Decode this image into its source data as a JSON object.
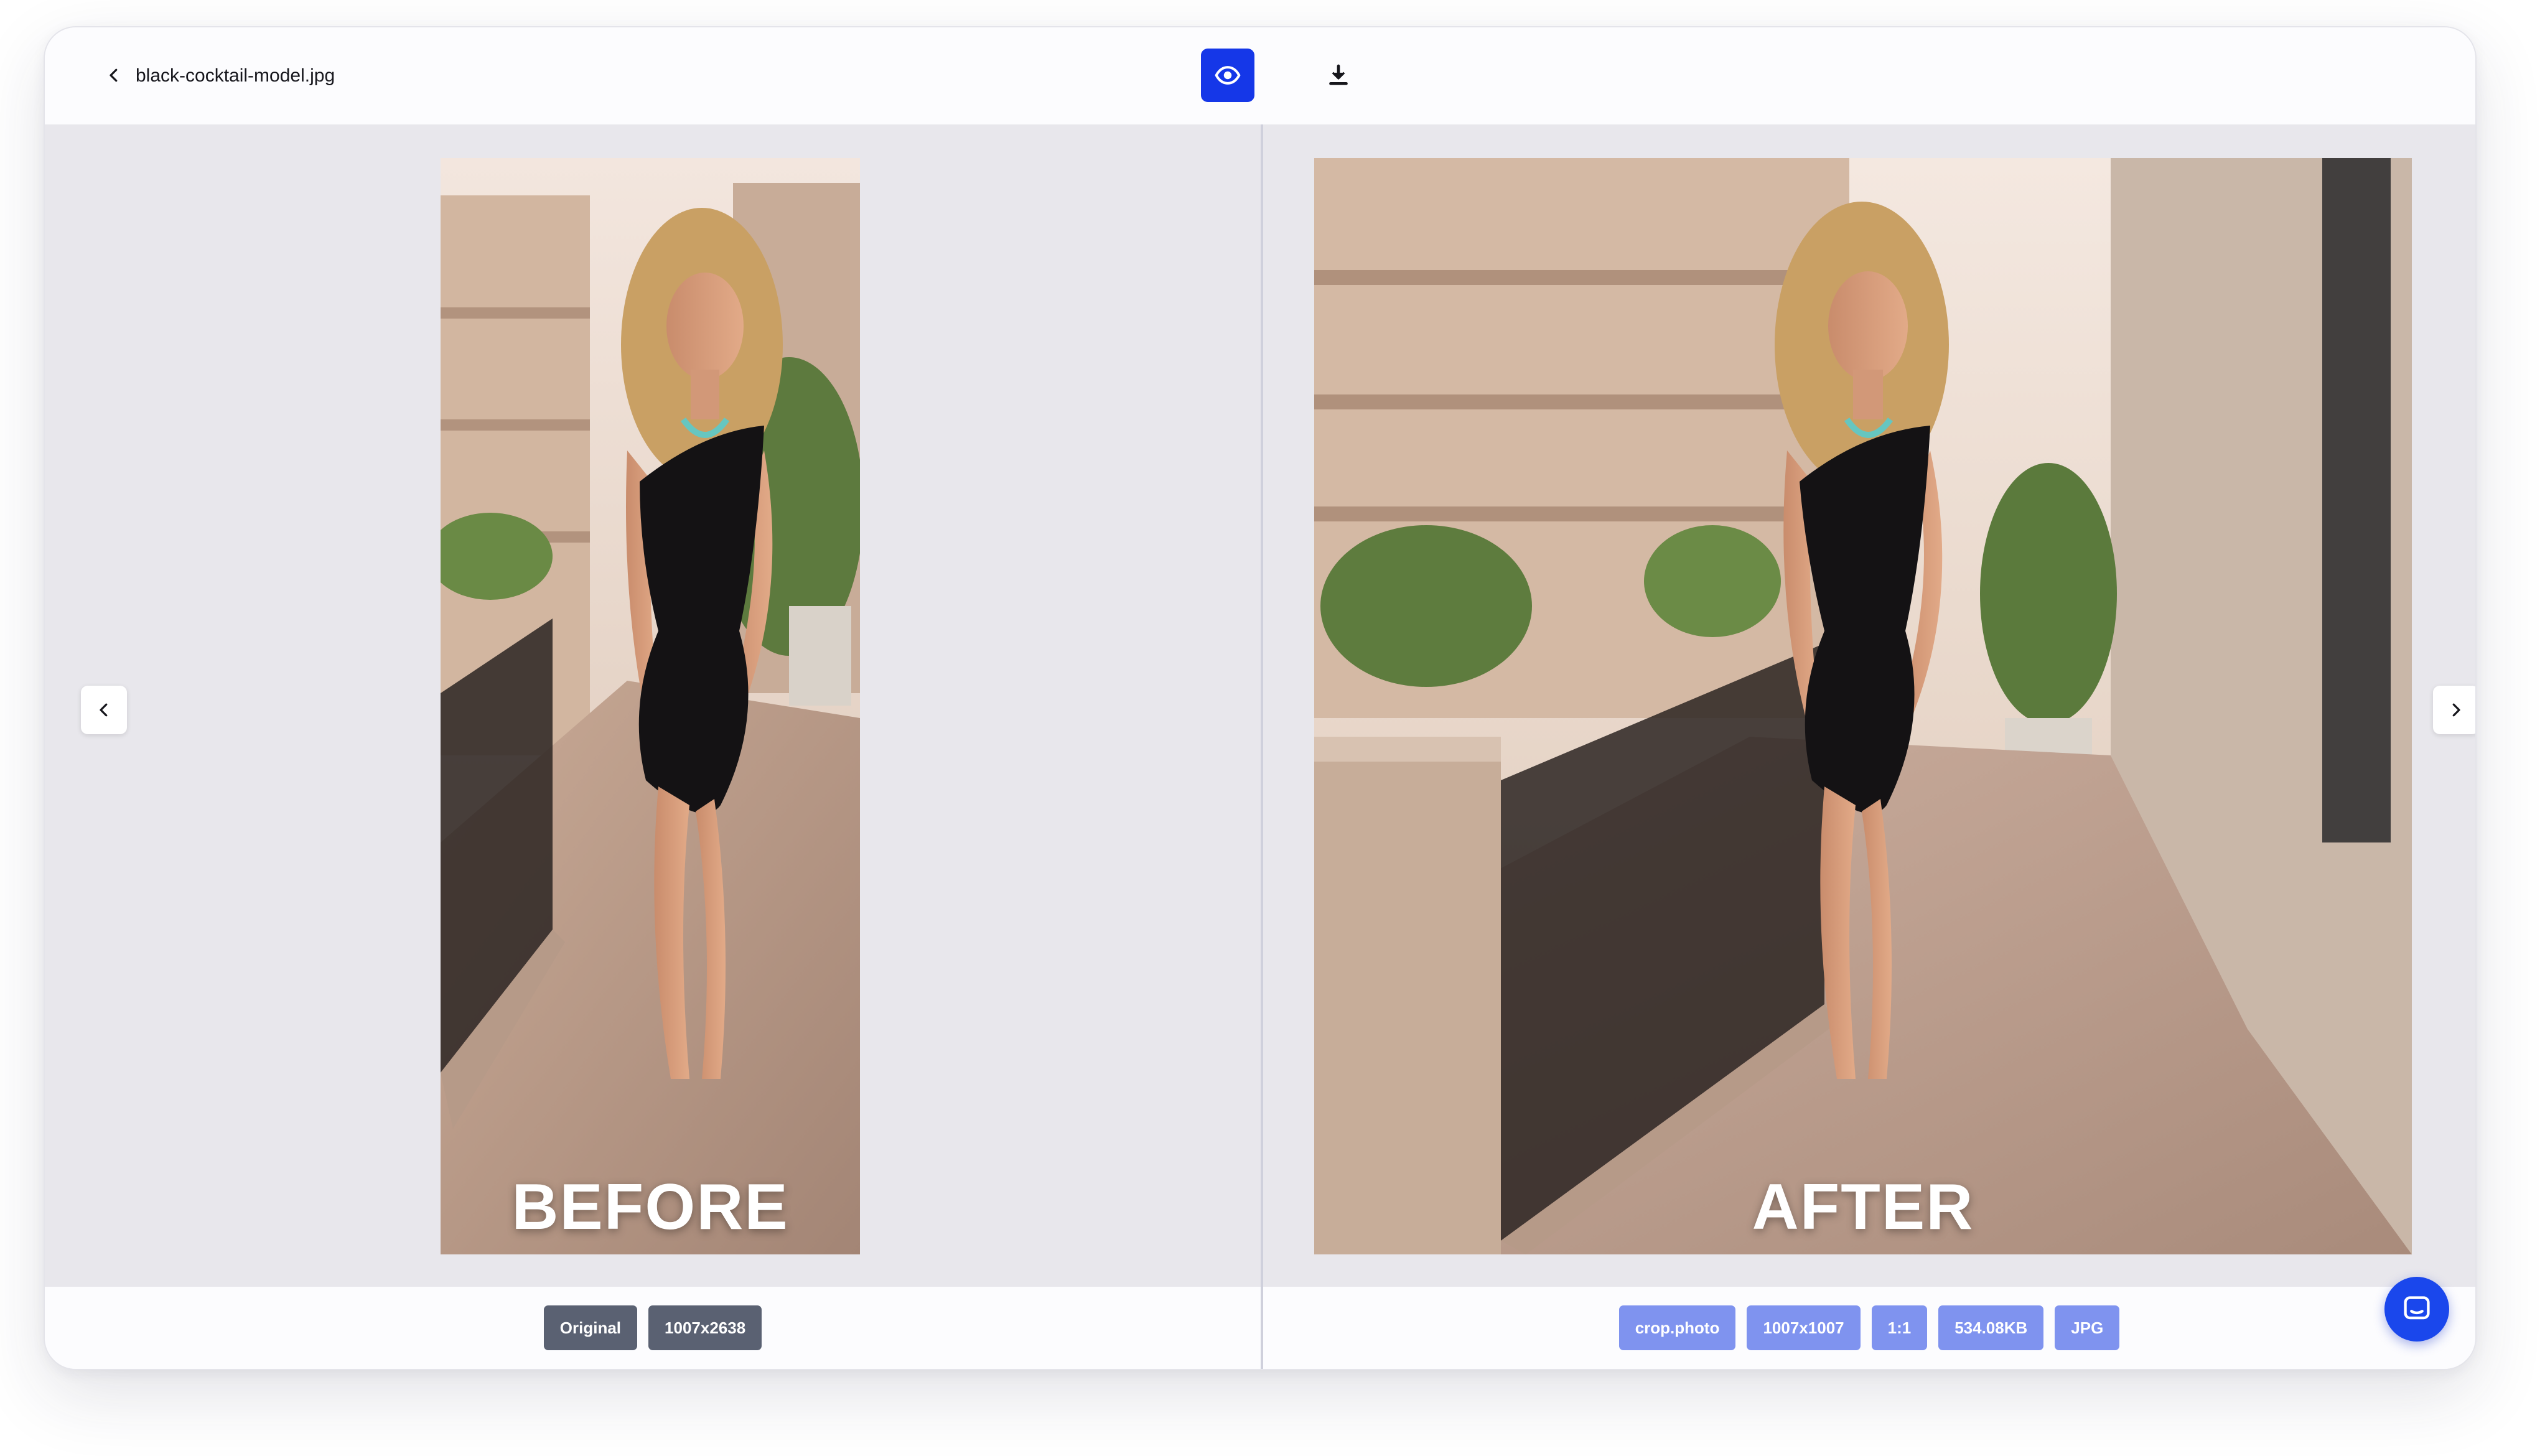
{
  "header": {
    "filename": "black-cocktail-model.jpg",
    "back_icon": "chevron-left-icon",
    "preview_icon": "eye-icon",
    "download_icon": "download-icon",
    "accent_color": "#1537e8"
  },
  "before": {
    "overlay_label": "BEFORE",
    "tags": [
      "Original",
      "1007x2638"
    ]
  },
  "after": {
    "overlay_label": "AFTER",
    "tags": [
      "crop.photo",
      "1007x1007",
      "1:1",
      "534.08KB",
      "JPG"
    ]
  },
  "navigation": {
    "prev_icon": "chevron-left-icon",
    "next_icon": "chevron-right-icon"
  },
  "chat": {
    "icon": "chat-bubble-icon",
    "color": "#1a47ec"
  }
}
